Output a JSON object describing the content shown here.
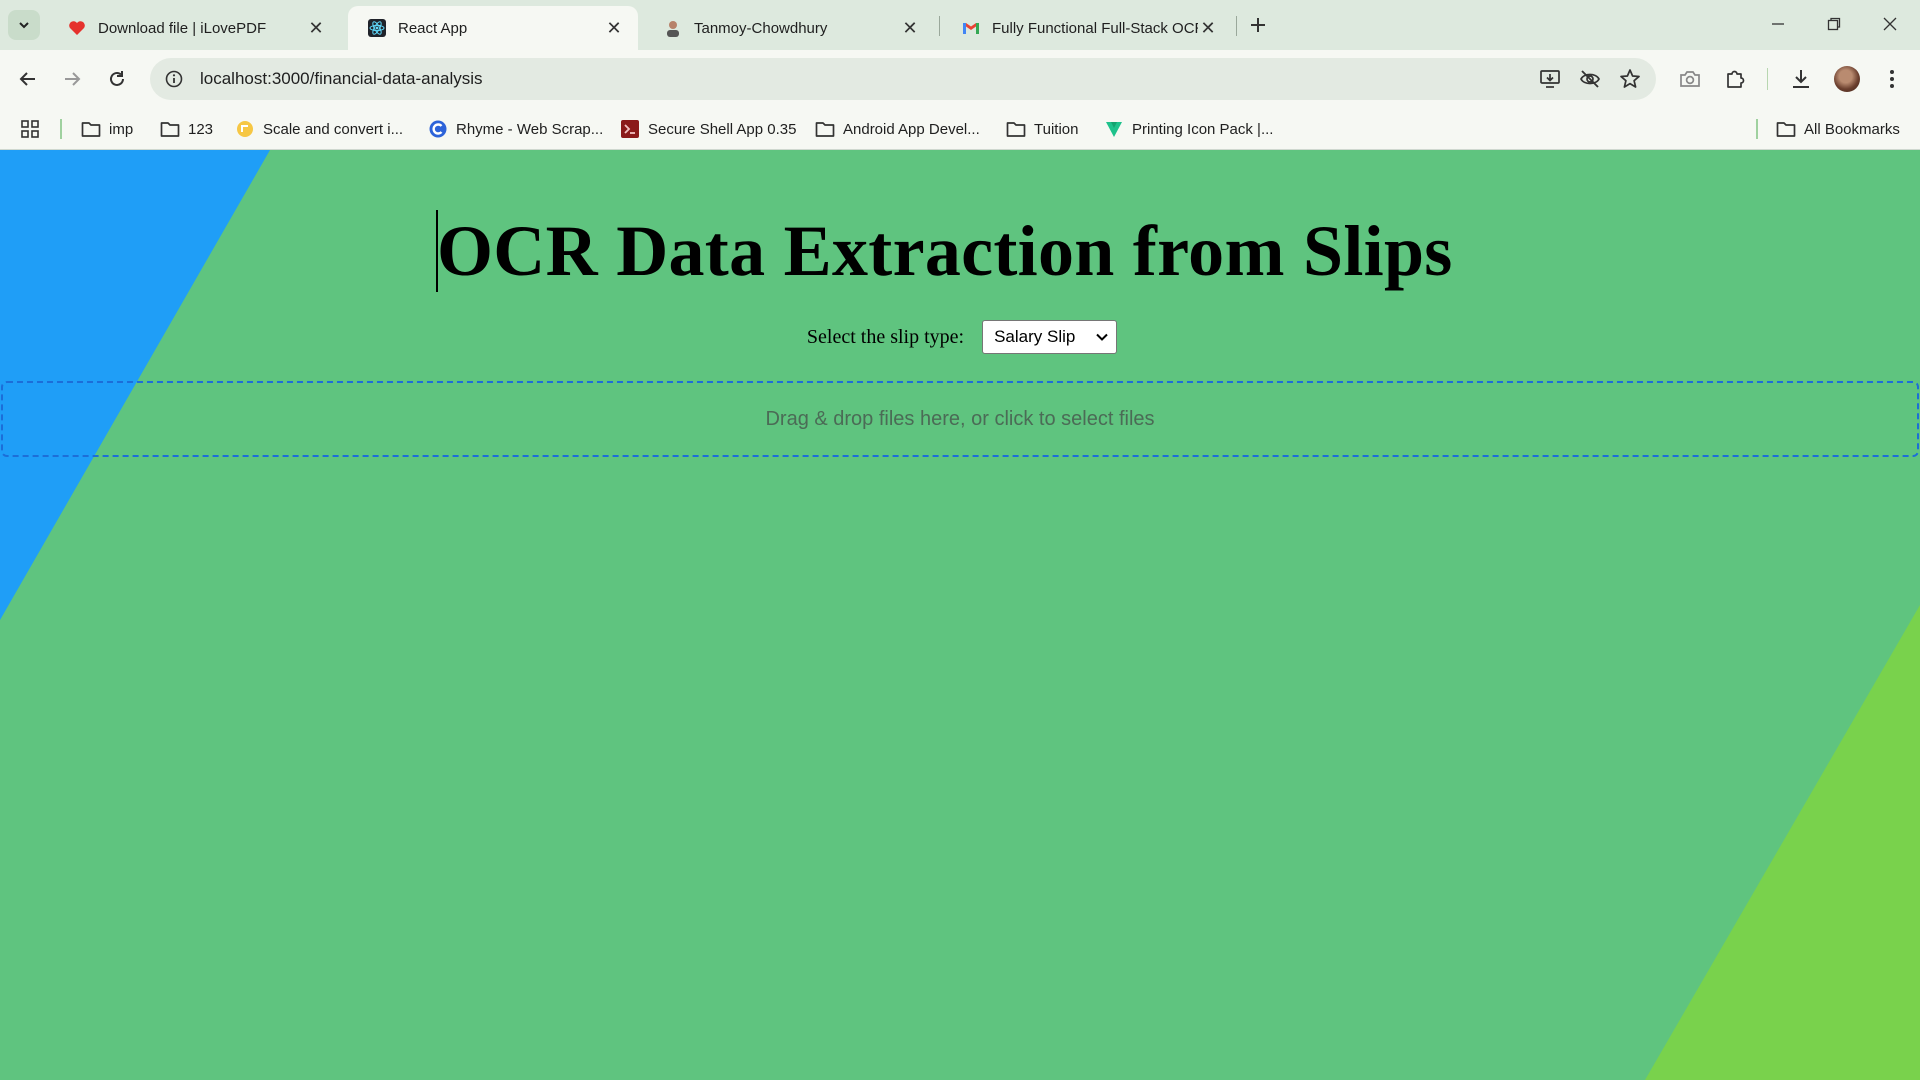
{
  "browser": {
    "tabs": [
      {
        "title": "Download file | iLovePDF",
        "icon": "heart-icon",
        "active": false
      },
      {
        "title": "React App",
        "icon": "react-icon",
        "active": true
      },
      {
        "title": "Tanmoy-Chowdhury",
        "icon": "avatar-icon",
        "active": false
      },
      {
        "title": "Fully Functional Full-Stack OCR",
        "icon": "gmail-icon",
        "active": false
      }
    ],
    "address": "localhost:3000/financial-data-analysis",
    "bookmarks": [
      {
        "label": "imp",
        "icon": "folder-icon"
      },
      {
        "label": "123",
        "icon": "folder-icon"
      },
      {
        "label": "Scale and convert i...",
        "icon": "scale-icon"
      },
      {
        "label": "Rhyme - Web Scrap...",
        "icon": "rhyme-icon"
      },
      {
        "label": "Secure Shell App 0.35",
        "icon": "terminal-icon"
      },
      {
        "label": "Android App Devel...",
        "icon": "folder-icon"
      },
      {
        "label": "Tuition",
        "icon": "folder-icon"
      },
      {
        "label": "Printing Icon Pack |...",
        "icon": "vuetify-icon"
      }
    ],
    "all_bookmarks": "All Bookmarks"
  },
  "page": {
    "heading": "OCR Data Extraction from Slips",
    "select_label": "Select the slip type:",
    "select_value": "Salary Slip",
    "dropzone_text": "Drag & drop files here, or click to select files"
  },
  "colors": {
    "background": "#5fc47f",
    "shape_blue": "#1f9ef7",
    "shape_lime": "#79d24c",
    "dropzone_border": "#1c6ed8"
  }
}
